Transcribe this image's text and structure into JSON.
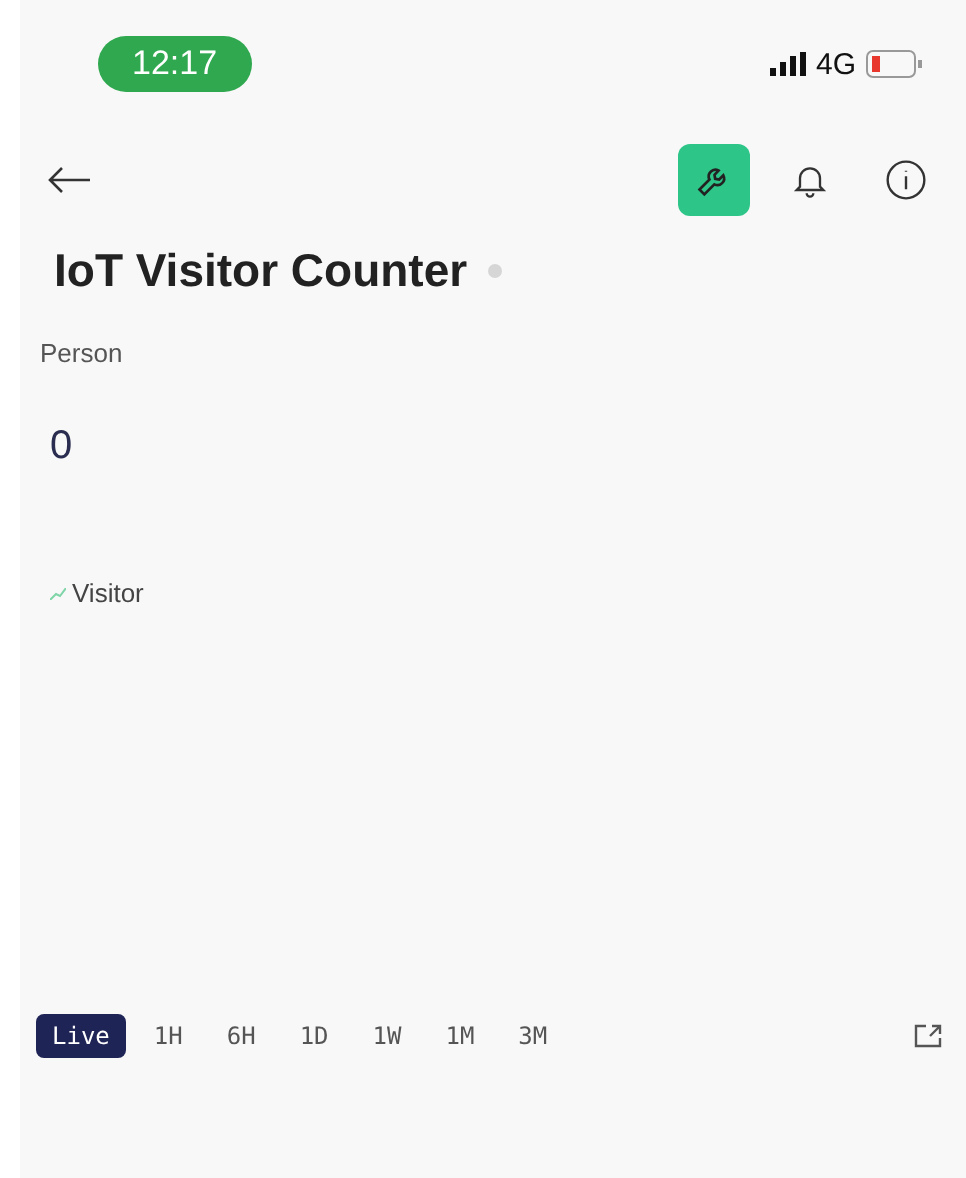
{
  "status_bar": {
    "time": "12:17",
    "network": "4G"
  },
  "toolbar": {
    "actions": [
      {
        "kind": "wrench",
        "selected": true
      },
      {
        "kind": "bell",
        "selected": false
      },
      {
        "kind": "info",
        "selected": false
      }
    ]
  },
  "title": "IoT Visitor Counter",
  "online": false,
  "widget": {
    "label": "Person",
    "value": "0",
    "legend": "Visitor"
  },
  "time_ranges": [
    {
      "label": "Live",
      "selected": true
    },
    {
      "label": "1H",
      "selected": false
    },
    {
      "label": "6H",
      "selected": false
    },
    {
      "label": "1D",
      "selected": false
    },
    {
      "label": "1W",
      "selected": false
    },
    {
      "label": "1M",
      "selected": false
    },
    {
      "label": "3M",
      "selected": false
    }
  ]
}
